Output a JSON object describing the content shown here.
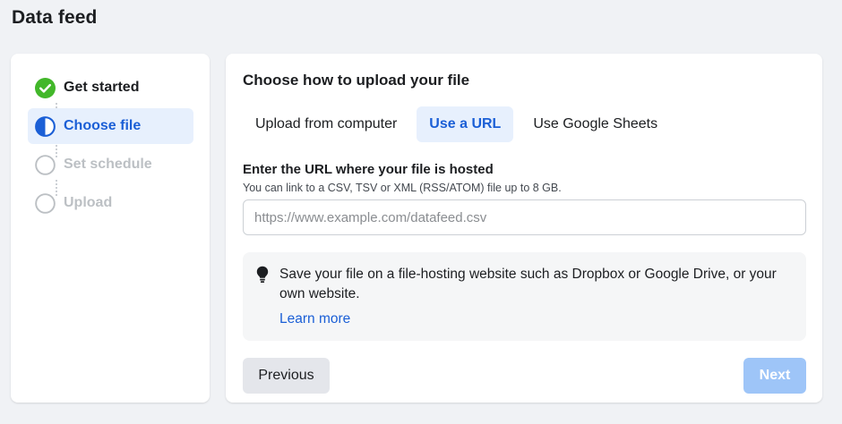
{
  "page": {
    "title": "Data feed"
  },
  "steps": [
    {
      "label": "Get started",
      "state": "done",
      "icon": "check-circle-icon"
    },
    {
      "label": "Choose file",
      "state": "active",
      "icon": "half-circle-icon"
    },
    {
      "label": "Set schedule",
      "state": "todo",
      "icon": "empty-circle-icon"
    },
    {
      "label": "Upload",
      "state": "todo",
      "icon": "empty-circle-icon"
    }
  ],
  "main": {
    "heading": "Choose how to upload your file",
    "tabs": [
      {
        "label": "Upload from computer",
        "selected": false
      },
      {
        "label": "Use a URL",
        "selected": true
      },
      {
        "label": "Use Google Sheets",
        "selected": false
      }
    ],
    "url_field": {
      "label": "Enter the URL where your file is hosted",
      "help": "You can link to a CSV, TSV or XML (RSS/ATOM) file up to 8 GB.",
      "placeholder": "https://www.example.com/datafeed.csv",
      "value": ""
    },
    "info": {
      "icon": "lightbulb-icon",
      "text": "Save your file on a file-hosting website such as Dropbox or Google Drive, or your own website.",
      "link": "Learn more"
    },
    "buttons": {
      "previous": "Previous",
      "next": "Next"
    }
  },
  "colors": {
    "accent": "#1b5fd6",
    "success": "#42b72a",
    "active_bg": "#e7f0fd",
    "disabled_button": "#9ec5f8",
    "background": "#f0f2f5"
  }
}
